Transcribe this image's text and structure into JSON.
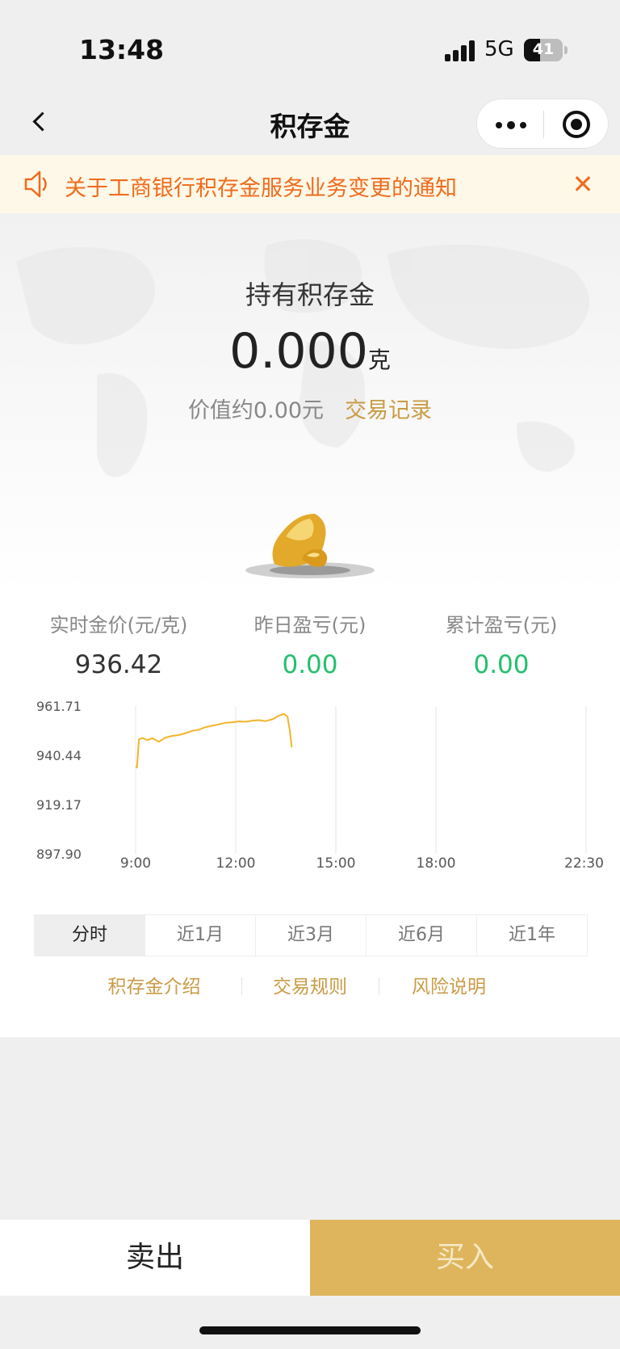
{
  "status_bar": {
    "time": "13:48",
    "network": "5G",
    "battery": "41",
    "battery_level": 0.41
  },
  "nav": {
    "title": "积存金",
    "icons": [
      "back-icon",
      "more-icon",
      "target-icon"
    ]
  },
  "notice": {
    "text": "关于工商银行积存金服务业务变更的通知",
    "close_label": "✕",
    "icon": "speaker-icon",
    "color": "#f06b1d",
    "background": "#fdf8e8"
  },
  "holding": {
    "label": "持有积存金",
    "amount": "0.000",
    "unit": "克",
    "value_text": "价值约0.00元",
    "records_link": "交易记录"
  },
  "stats": [
    {
      "label": "实时金价(元/克)",
      "value": "936.42"
    },
    {
      "label": "昨日盈亏(元)",
      "value": "0.00"
    },
    {
      "label": "累计盈亏(元)",
      "value": "0.00"
    }
  ],
  "chart_data": {
    "type": "line",
    "title": "",
    "xlabel": "",
    "ylabel": "",
    "y_ticks": [
      "961.71",
      "940.44",
      "919.17",
      "897.90"
    ],
    "x_ticks": [
      "9:00",
      "12:00",
      "15:00",
      "18:00",
      "22:30"
    ],
    "ylim": [
      897.9,
      961.71
    ],
    "x_hours": [
      9.0,
      9.04,
      9.1,
      9.2,
      9.35,
      9.5,
      9.7,
      9.9,
      10.1,
      10.3,
      10.5,
      10.7,
      10.9,
      11.1,
      11.3,
      11.5,
      11.7,
      11.9,
      12.1,
      12.3,
      12.5,
      12.7,
      12.9,
      13.1,
      13.3,
      13.45,
      13.55,
      13.62,
      13.68
    ],
    "values": [
      935.2,
      935.2,
      947.3,
      947.9,
      947.0,
      947.8,
      946.3,
      948.1,
      948.8,
      949.2,
      950.0,
      951.0,
      951.5,
      952.6,
      953.2,
      953.8,
      954.5,
      954.7,
      955.1,
      954.9,
      955.4,
      955.6,
      955.2,
      956.0,
      957.6,
      958.3,
      957.1,
      951.2,
      943.9
    ],
    "grid": true,
    "line_color": "#f0b52a"
  },
  "periods": [
    "分时",
    "近1月",
    "近3月",
    "近6月",
    "近1年"
  ],
  "active_period": 0,
  "links": [
    "积存金介绍",
    "交易规则",
    "风险说明"
  ],
  "actions": {
    "sell": "卖出",
    "buy": "买入",
    "buy_color": "#deb55c"
  }
}
